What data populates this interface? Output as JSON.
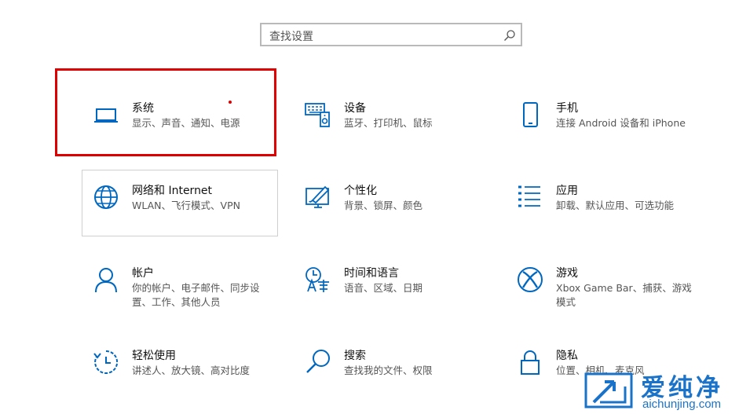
{
  "search": {
    "placeholder": "查找设置"
  },
  "tiles": [
    {
      "title": "系统",
      "desc": "显示、声音、通知、电源",
      "icon": "laptop-icon"
    },
    {
      "title": "设备",
      "desc": "蓝牙、打印机、鼠标",
      "icon": "devices-icon"
    },
    {
      "title": "手机",
      "desc": "连接 Android 设备和 iPhone",
      "icon": "phone-icon"
    },
    {
      "title": "网络和 Internet",
      "desc": "WLAN、飞行模式、VPN",
      "icon": "globe-icon"
    },
    {
      "title": "个性化",
      "desc": "背景、锁屏、颜色",
      "icon": "paint-icon"
    },
    {
      "title": "应用",
      "desc": "卸载、默认应用、可选功能",
      "icon": "apps-list-icon"
    },
    {
      "title": "帐户",
      "desc": "你的帐户、电子邮件、同步设置、工作、其他人员",
      "icon": "person-icon"
    },
    {
      "title": "时间和语言",
      "desc": "语音、区域、日期",
      "icon": "time-language-icon"
    },
    {
      "title": "游戏",
      "desc": "Xbox Game Bar、捕获、游戏模式",
      "icon": "xbox-icon"
    },
    {
      "title": "轻松使用",
      "desc": "讲述人、放大镜、高对比度",
      "icon": "ease-of-access-icon"
    },
    {
      "title": "搜索",
      "desc": "查找我的文件、权限",
      "icon": "search-icon"
    },
    {
      "title": "隐私",
      "desc": "位置、相机、麦克风",
      "icon": "lock-icon"
    }
  ],
  "watermark": {
    "brand": "爱纯净",
    "url": "aichunjing.com"
  },
  "colors": {
    "accent": "#0067c0",
    "highlight": "#e00000"
  }
}
